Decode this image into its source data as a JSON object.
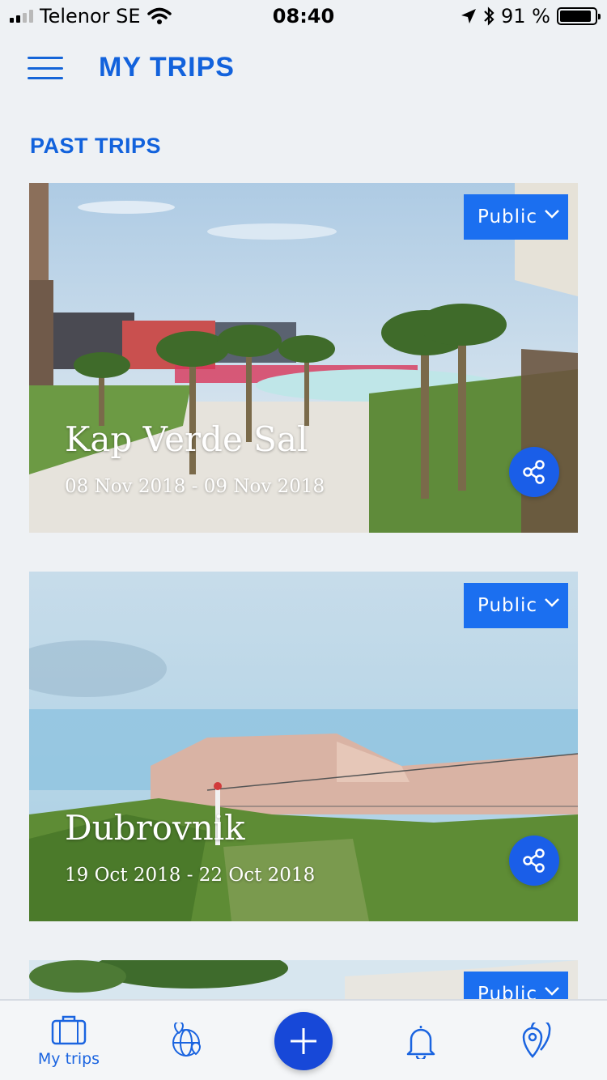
{
  "status_bar": {
    "carrier": "Telenor SE",
    "time": "08:40",
    "battery": "91 %",
    "battery_level": 0.91
  },
  "header": {
    "title": "MY TRIPS"
  },
  "section": {
    "title": "PAST TRIPS"
  },
  "trips": [
    {
      "name": "Kap Verde Sal",
      "dates": "08 Nov 2018 - 09 Nov 2018",
      "privacy": "Public"
    },
    {
      "name": "Dubrovnik",
      "dates": "19 Oct 2018 - 22 Oct 2018",
      "privacy": "Public"
    },
    {
      "privacy": "Public"
    }
  ],
  "bottom_nav": {
    "items": [
      {
        "label": "My trips",
        "icon": "suitcase-icon"
      },
      {
        "icon": "globe-pin-icon"
      },
      {
        "icon": "plus-icon"
      },
      {
        "icon": "bell-icon"
      },
      {
        "icon": "map-pins-icon"
      }
    ]
  },
  "colors": {
    "accent": "#1262dc",
    "button": "#1b6ff0",
    "fab": "#1748d8"
  }
}
